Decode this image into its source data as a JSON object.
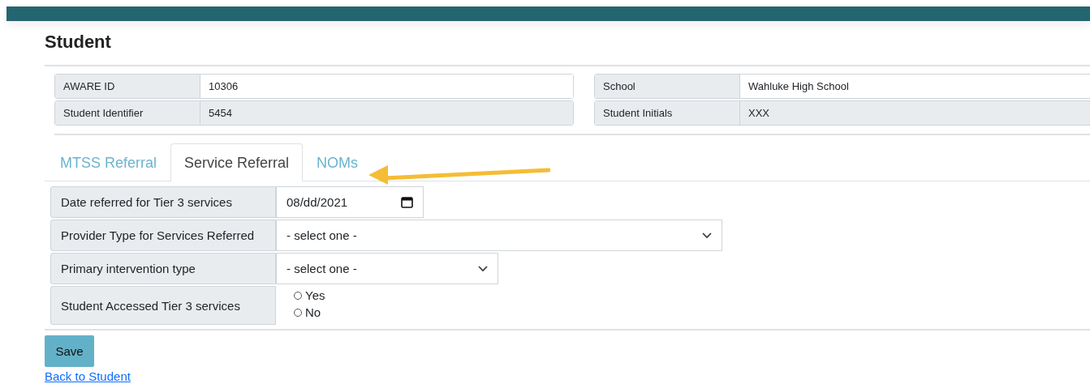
{
  "page": {
    "title": "Student"
  },
  "student_info": {
    "left": [
      {
        "label": "AWARE ID",
        "value": "10306",
        "editable": true
      },
      {
        "label": "Student Identifier",
        "value": "5454",
        "editable": false
      }
    ],
    "right": [
      {
        "label": "School",
        "value": "Wahluke High School",
        "editable": true
      },
      {
        "label": "Student Initials",
        "value": "XXX",
        "editable": false
      }
    ]
  },
  "tabs": [
    {
      "label": "MTSS Referral",
      "selected": false
    },
    {
      "label": "Service Referral",
      "selected": true
    },
    {
      "label": "NOMs",
      "selected": false
    }
  ],
  "form": [
    {
      "kind": "date",
      "label": "Date referred for Tier 3 services",
      "value": "08/dd/2021"
    },
    {
      "kind": "select",
      "label": "Provider Type for Services Referred",
      "value": "- select one -"
    },
    {
      "kind": "select",
      "label": "Primary intervention type",
      "value": "- select one -"
    },
    {
      "kind": "radio",
      "label": "Student Accessed Tier 3 services",
      "options": [
        {
          "label": "Yes",
          "selected": false
        },
        {
          "label": "No",
          "selected": false
        }
      ]
    }
  ],
  "save_button": "Save",
  "back_link": "Back to Student"
}
